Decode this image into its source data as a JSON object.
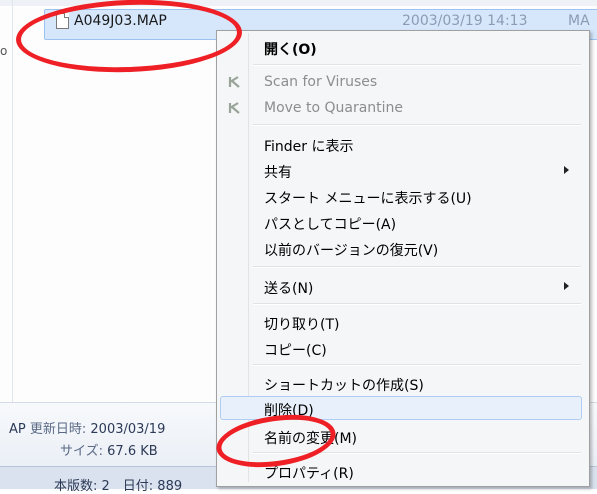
{
  "explorer": {
    "left_glyph": "o",
    "selected_file": {
      "name": "A049J03.MAP",
      "modified": "2003/03/19 14:13",
      "type_prefix": "MA"
    },
    "details": {
      "name_fragment": "AP",
      "modified_label": "更新日時:",
      "modified_value": "2003/03/19",
      "size_label": "サイズ:",
      "size_value": "67.6 KB"
    },
    "status_partial": "本版数: 2　日付: 889"
  },
  "context_menu": {
    "items": [
      {
        "label": "開く(O)",
        "bold": true,
        "disabled": false
      },
      {
        "label": "Scan for Viruses",
        "disabled": true,
        "icon": "kaspersky-k-icon"
      },
      {
        "label": "Move to Quarantine",
        "disabled": true,
        "icon": "kaspersky-k-icon"
      },
      {
        "label": "Finder に表示"
      },
      {
        "label": "共有",
        "submenu": true
      },
      {
        "label": "スタート メニューに表示する(U)"
      },
      {
        "label": "パスとしてコピー(A)"
      },
      {
        "label": "以前のバージョンの復元(V)"
      },
      {
        "label": "送る(N)",
        "submenu": true
      },
      {
        "label": "切り取り(T)"
      },
      {
        "label": "コピー(C)"
      },
      {
        "label": "ショートカットの作成(S)"
      },
      {
        "label": "削除(D)",
        "highlighted": true
      },
      {
        "label": "名前の変更(M)"
      },
      {
        "label": "プロパティ(R)"
      }
    ]
  },
  "colors": {
    "annotation_red": "#ee2026",
    "highlight_bg": "#e8f1fb",
    "selection_bg": "#d6e7fb",
    "disabled_text": "#8d8d8d"
  }
}
